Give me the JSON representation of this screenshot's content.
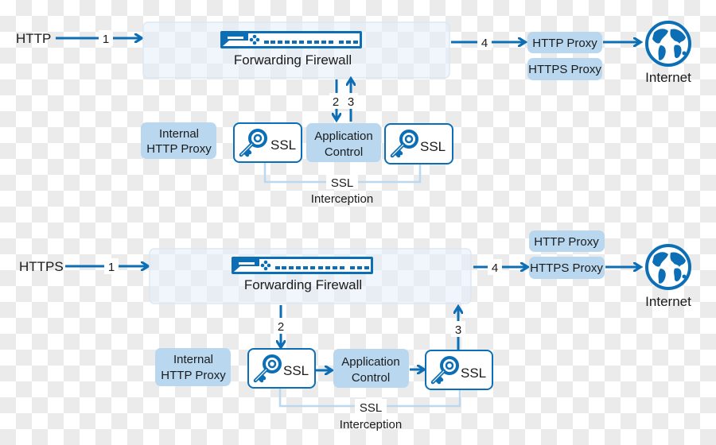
{
  "colors": {
    "accent": "#0c6fb6",
    "light_box": "#b9d8f0",
    "bracket": "#bcd8ee"
  },
  "icons": {
    "firewall": "firewall-device-icon",
    "ssl": "key-icon",
    "internet": "globe-icon"
  },
  "http_flow": {
    "source": "HTTP",
    "step1": "1",
    "step2": "2",
    "step3": "3",
    "step4": "4",
    "firewall": "Forwarding Firewall",
    "internal_proxy": [
      "Internal",
      "HTTP Proxy"
    ],
    "ssl_left": "SSL",
    "app_control": [
      "Application",
      "Control"
    ],
    "ssl_right": "SSL",
    "interception": [
      "SSL",
      "Interception"
    ],
    "http_proxy": "HTTP Proxy",
    "https_proxy": "HTTPS Proxy",
    "internet": "Internet"
  },
  "https_flow": {
    "source": "HTTPS",
    "step1": "1",
    "step2": "2",
    "step3": "3",
    "step4": "4",
    "firewall": "Forwarding Firewall",
    "internal_proxy": [
      "Internal",
      "HTTP Proxy"
    ],
    "ssl_left": "SSL",
    "app_control": [
      "Application",
      "Control"
    ],
    "ssl_right": "SSL",
    "interception": [
      "SSL",
      "Interception"
    ],
    "http_proxy": "HTTP Proxy",
    "https_proxy": "HTTPS Proxy",
    "internet": "Internet"
  }
}
